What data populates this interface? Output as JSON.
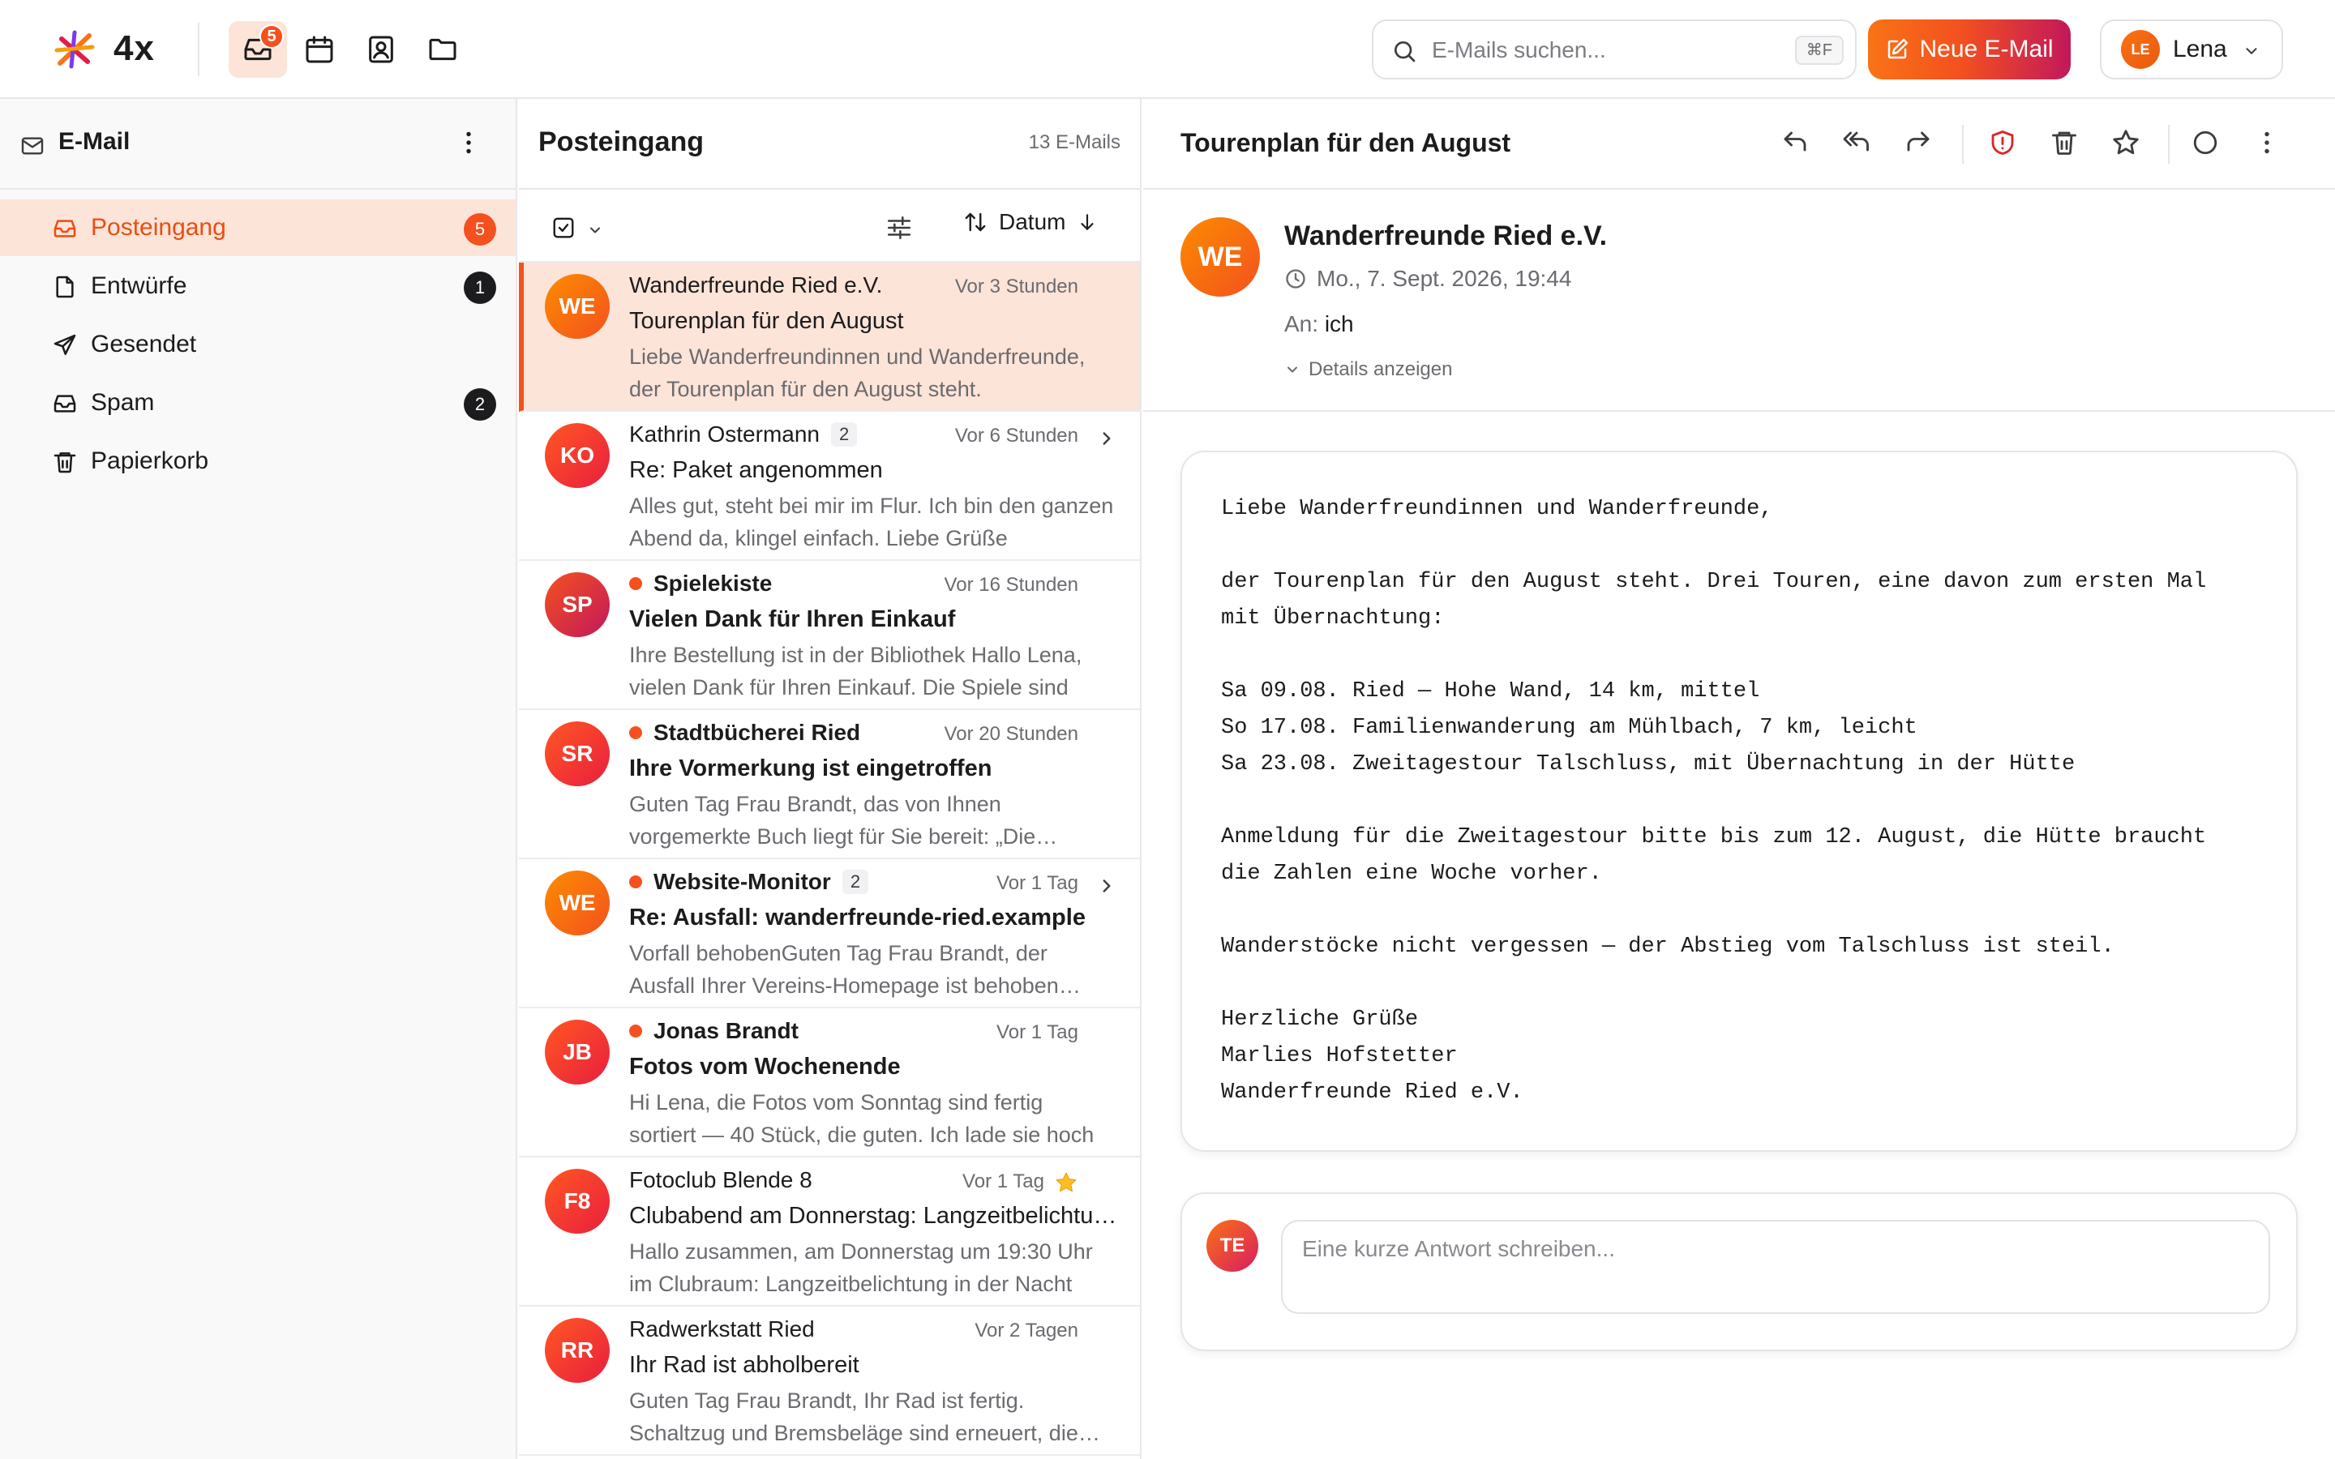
{
  "app": {
    "brand": "4x",
    "mail_badge": "5"
  },
  "search": {
    "placeholder": "E-Mails suchen...",
    "shortcut": "⌘F"
  },
  "compose_label": "Neue E-Mail",
  "user": {
    "initials": "LE",
    "name": "Lena"
  },
  "sidebar": {
    "title": "E-Mail",
    "items": [
      {
        "label": "Posteingang",
        "count": "5",
        "icon": "inbox-icon",
        "active": true
      },
      {
        "label": "Entwürfe",
        "count": "1",
        "icon": "file-icon"
      },
      {
        "label": "Gesendet",
        "count": "",
        "icon": "send-icon"
      },
      {
        "label": "Spam",
        "count": "2",
        "icon": "spam-icon"
      },
      {
        "label": "Papierkorb",
        "count": "",
        "icon": "trash-icon"
      }
    ]
  },
  "list": {
    "title": "Posteingang",
    "count": "13 E-Mails",
    "sort_label": "Datum",
    "messages": [
      {
        "initials": "WE",
        "from": "Wanderfreunde Ried e.V.",
        "time": "Vor 3 Stunden",
        "subject": "Tourenplan für den August",
        "preview": "Liebe Wanderfreundinnen und Wanderfreunde, der Tourenplan für den August steht.",
        "thread": "",
        "unread": false,
        "selected": true
      },
      {
        "initials": "KO",
        "from": "Kathrin Ostermann",
        "time": "Vor 6 Stunden",
        "subject": "Re: Paket angenommen",
        "preview": "Alles gut, steht bei mir im Flur. Ich bin den ganzen Abend da, klingel einfach. Liebe Grüße",
        "thread": "2",
        "unread": false
      },
      {
        "initials": "SP",
        "from": "Spielekiste",
        "time": "Vor 16 Stunden",
        "subject": "Vielen Dank für Ihren Einkauf",
        "preview": "Ihre Bestellung ist in der Bibliothek Hallo Lena, vielen Dank für Ihren Einkauf. Die Spiele sind",
        "thread": "",
        "unread": true
      },
      {
        "initials": "SR",
        "from": "Stadtbücherei Ried",
        "time": "Vor 20 Stunden",
        "subject": "Ihre Vormerkung ist eingetroffen",
        "preview": "Guten Tag Frau Brandt, das von Ihnen vorgemerkte Buch liegt für Sie bereit: „Die Wanderer",
        "thread": "",
        "unread": true
      },
      {
        "initials": "WE",
        "from": "Website-Monitor",
        "time": "Vor 1 Tag",
        "subject": "Re: Ausfall: wanderfreunde-ried.example",
        "preview": "Vorfall behobenGuten Tag Frau Brandt, der Ausfall Ihrer Vereins-Homepage ist behoben worden",
        "thread": "2",
        "unread": true
      },
      {
        "initials": "JB",
        "from": "Jonas Brandt",
        "time": "Vor 1 Tag",
        "subject": "Fotos vom Wochenende",
        "preview": "Hi Lena, die Fotos vom Sonntag sind fertig sortiert — 40 Stück, die guten. Ich lade sie hoch",
        "thread": "",
        "unread": true
      },
      {
        "initials": "F8",
        "from": "Fotoclub Blende 8",
        "time": "Vor 1 Tag",
        "subject": "Clubabend am Donnerstag: Langzeitbelichtung",
        "preview": "Hallo zusammen, am Donnerstag um 19:30 Uhr im Clubraum: Langzeitbelichtung in der Nacht",
        "thread": "",
        "unread": false,
        "starred": true
      },
      {
        "initials": "RR",
        "from": "Radwerkstatt Ried",
        "time": "Vor 2 Tagen",
        "subject": "Ihr Rad ist abholbereit",
        "preview": "Guten Tag Frau Brandt, Ihr Rad ist fertig. Schaltzug und Bremsbeläge sind erneuert, die Kette",
        "thread": "",
        "unread": false
      }
    ]
  },
  "reader": {
    "title": "Tourenplan für den August",
    "sender_initials": "WE",
    "sender_name": "Wanderfreunde Ried e.V.",
    "date": "Mo., 7. Sept. 2026, 19:44",
    "to_label": "An:",
    "to_value": "ich",
    "details_label": "Details anzeigen",
    "body": "Liebe Wanderfreundinnen und Wanderfreunde,\n\nder Tourenplan für den August steht. Drei Touren, eine davon zum ersten Mal\nmit Übernachtung:\n\nSa 09.08. Ried — Hohe Wand, 14 km, mittel\nSo 17.08. Familienwanderung am Mühlbach, 7 km, leicht\nSa 23.08. Zweitagestour Talschluss, mit Übernachtung in der Hütte\n\nAnmeldung für die Zweitagestour bitte bis zum 12. August, die Hütte braucht\ndie Zahlen eine Woche vorher.\n\nWanderstöcke nicht vergessen — der Abstieg vom Talschluss ist steil.\n\nHerzliche Grüße\nMarlies Hofstetter\nWanderfreunde Ried e.V.",
    "reply_initials": "TE",
    "reply_placeholder": "Eine kurze Antwort schreiben..."
  },
  "colors": {
    "accent": "#f4511e",
    "accent_soft": "#fde4d8",
    "star": "#fbbf24"
  }
}
